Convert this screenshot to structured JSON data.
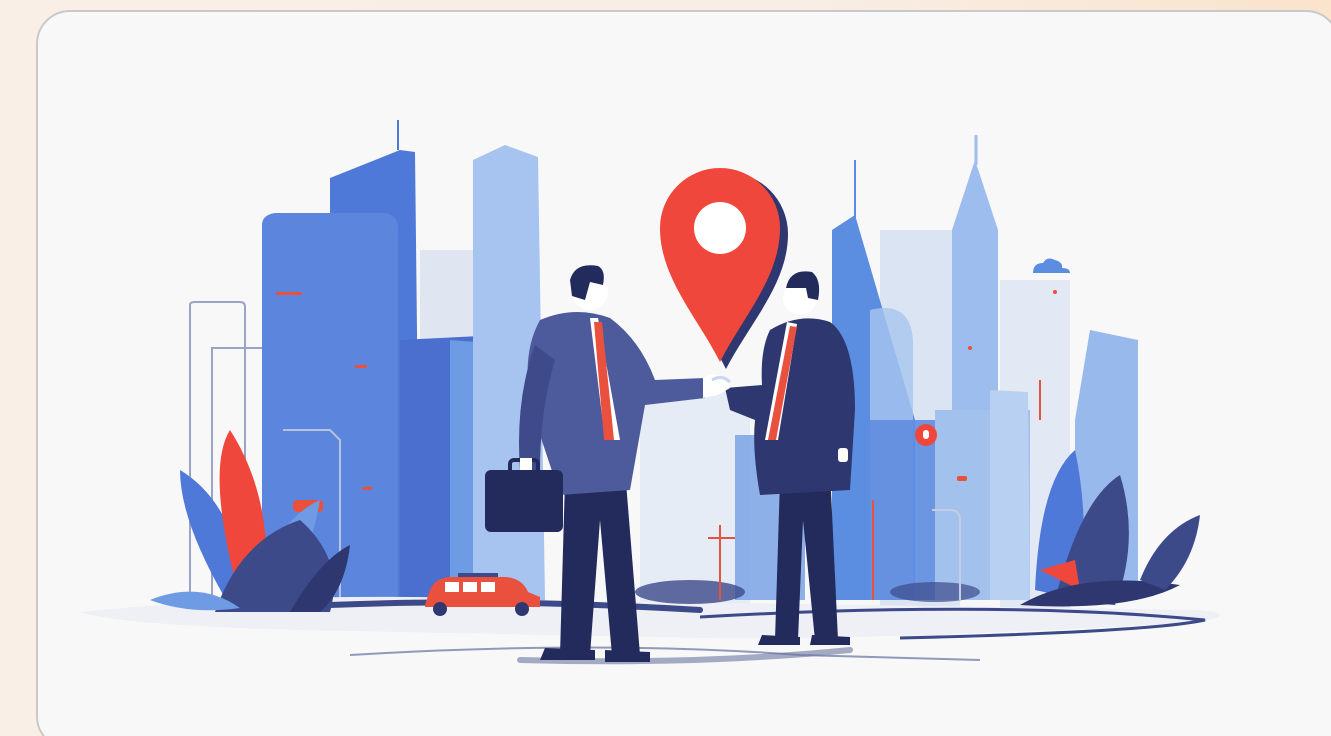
{
  "scene": {
    "subject": "handshake",
    "icons": [
      "location-pin-icon",
      "cloud-icon",
      "briefcase-icon",
      "car-icon"
    ],
    "colors": {
      "background": "#f8f8f8",
      "frame": "#c9c9c9",
      "building_dark": "#4f79d8",
      "building_mid": "#6e9be3",
      "building_light": "#a8c4ef",
      "suit_left": "#4d5a9c",
      "suit_right": "#2e3770",
      "pants": "#232a5c",
      "tie": "#e9503e",
      "pin": "#f0473c",
      "plant": "#3c4a8a",
      "car": "#e9503e"
    }
  }
}
